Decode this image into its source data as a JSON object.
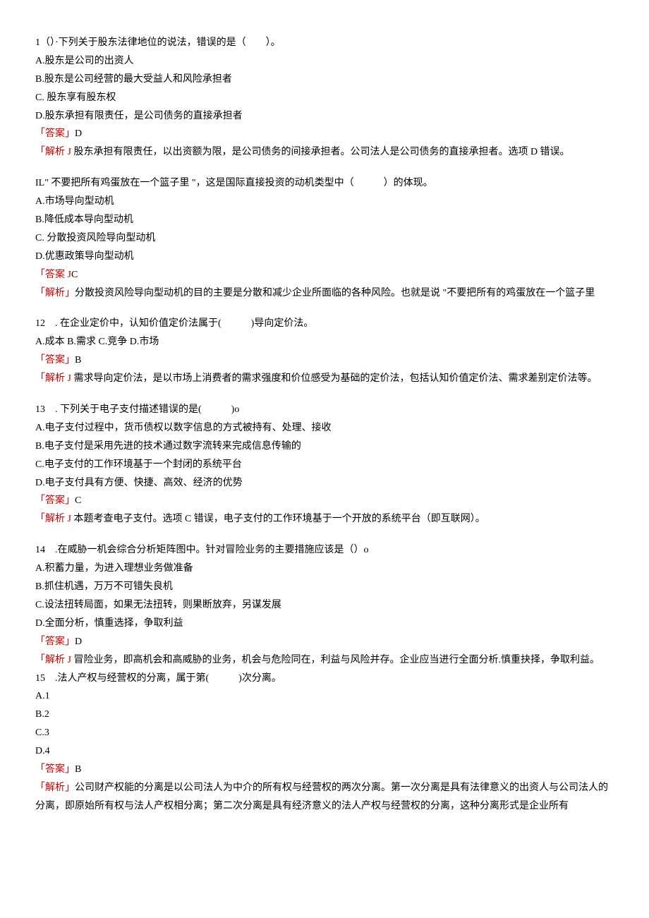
{
  "q1": {
    "stem": "1（）·下列关于股东法律地位的说法，错误的是（　　）。",
    "optA": "A.股东是公司的出资人",
    "optB": "B.股东是公司经营的最大受益人和风险承担者",
    "optC": "C. 股东享有股东权",
    "optD": "D.股东承担有限责任，是公司债务的直接承担者",
    "ansLabel": "「答案」",
    "ans": "D",
    "anaLabel": "「解析 J",
    "ana": " 股东承担有限责任，以出资额为限，是公司债务的间接承担者。公司法人是公司债务的直接承担者。选项 D 错误。"
  },
  "q2": {
    "stem": "IL\" 不要把所有鸡蛋放在一个篮子里 \"，这是国际直接投资的动机类型中（　　　）的体现。",
    "optA": "A.市场导向型动机",
    "optB": "B.降低成本导向型动机",
    "optC": "C. 分散投资风险导向型动机",
    "optD": "D.优惠政策导向型动机",
    "ansLabel": "「答案 J",
    "ans": "C",
    "anaLabel": "「解析」",
    "ana": "分散投资风险导向型动机的目的主要是分散和减少企业所面临的各种风险。也就是说 \"不要把所有的鸡蛋放在一个篮子里 "
  },
  "q3": {
    "stem": "12　. 在企业定价中，认知价值定价法属于(　　　)导向定价法。",
    "opt": "A.成本 B.需求 C.竞争 D.市场",
    "ansLabel": "「答案」",
    "ans": "B",
    "anaLabel": "「解析 J",
    "ana": " 需求导向定价法，是以市场上消费者的需求强度和价位感受为基础的定价法，包括认知价值定价法、需求差别定价法等。"
  },
  "q4": {
    "stem": "13　. 下列关于电子支付描述错误的是(　　　)o",
    "optA": "A.电子支付过程中，货币债权以数字信息的方式被持有、处理、接收",
    "optB": "B.电子支付是采用先进的技术通过数字流转来完成信息传输的",
    "optC": "C.电子支付的工作环境基于一个封闭的系统平台",
    "optD": "D.电子支付具有方便、快捷、高效、经济的优势",
    "ansLabel": "「答案」",
    "ans": "C",
    "anaLabel": "「解析 J",
    "ana": " 本题考查电子支付。选项 C 错误，电子支付的工作环境基于一个开放的系统平台（即互联网）。"
  },
  "q5": {
    "stem": "14　.在威胁一机会综合分析矩阵图中。针对冒险业务的主要措施应该是（）o",
    "optA": "A.积蓄力量，为进入理想业务做准备",
    "optB": "B.抓住机遇，万万不可错失良机",
    "optC": "C.设法扭转局面，如果无法扭转，则果断放弃，另谋发展",
    "optD": "D.全面分析，慎重选择，争取利益",
    "ansLabel": "「答案」",
    "ans": "D",
    "anaLabel": "「解析 J",
    "ana": " 冒险业务，即高机会和高威胁的业务，机会与危险同在，利益与风险并存。企业应当进行全面分析.慎重抉择，争取利益。"
  },
  "q6": {
    "stem": "15　.法人产权与经营权的分离，属于第(　　　)次分离。",
    "optA": "A.1",
    "optB": "B.2",
    "optC": "C.3",
    "optD": "D.4",
    "ansLabel": "「答案」",
    "ans": "B",
    "anaLabel": "「解析」",
    "ana": "公司财产权能的分离是以公司法人为中介的所有权与经营权的两次分离。第一次分离是具有法律意义的出资人与公司法人的分离，即原始所有权与法人产权相分离；第二次分离是具有经济意义的法人产权与经营权的分离，这种分离形式是企业所有"
  }
}
